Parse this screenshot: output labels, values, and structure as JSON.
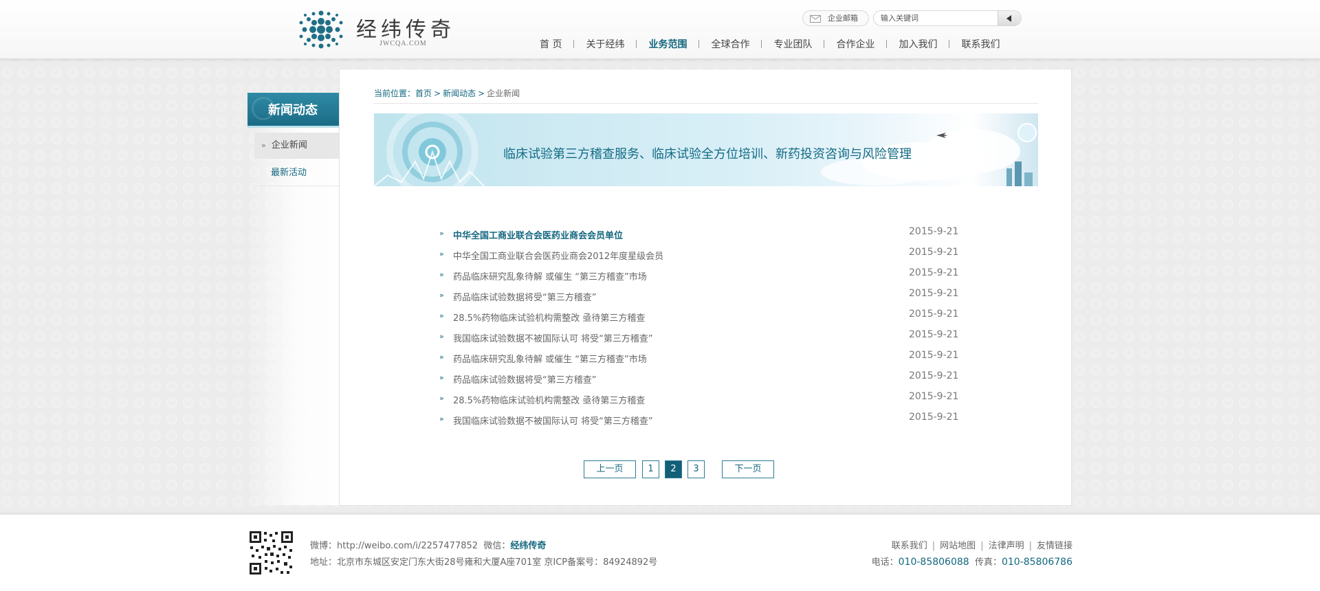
{
  "header": {
    "logo_text": "经纬传奇",
    "logo_sub": "JWCQA.COM",
    "mail_label": "企业邮箱",
    "search_placeholder": "输入关键词",
    "nav": [
      "首 页",
      "关于经纬",
      "业务范围",
      "全球合作",
      "专业团队",
      "合作企业",
      "加入我们",
      "联系我们"
    ],
    "nav_active_index": 2
  },
  "sidebar": {
    "title": "新闻动态",
    "items": [
      {
        "label": "企业新闻",
        "active": true
      },
      {
        "label": "最新活动",
        "active": false
      }
    ]
  },
  "breadcrumb": {
    "prefix": "当前位置：",
    "home": "首页",
    "section": "新闻动态",
    "current": "企业新闻"
  },
  "banner": {
    "text": "临床试验第三方稽查服务、临床试验全方位培训、新药投资咨询与风险管理"
  },
  "news": [
    {
      "title": "中华全国工商业联合会医药业商会会员单位",
      "date": "2015-9-21",
      "highlight": true
    },
    {
      "title": "中华全国工商业联合会医药业商会2012年度星级会员",
      "date": "2015-9-21",
      "highlight": false
    },
    {
      "title": "药品临床研究乱象待解 或催生 “第三方稽查”市场",
      "date": "2015-9-21",
      "highlight": false
    },
    {
      "title": "药品临床试验数据将受“第三方稽查”",
      "date": "2015-9-21",
      "highlight": false
    },
    {
      "title": "28.5%药物临床试验机构需整改 亟待第三方稽查",
      "date": "2015-9-21",
      "highlight": false
    },
    {
      "title": "我国临床试验数据不被国际认可 将受“第三方稽查”",
      "date": "2015-9-21",
      "highlight": false
    },
    {
      "title": "药品临床研究乱象待解 或催生 “第三方稽查”市场",
      "date": "2015-9-21",
      "highlight": false
    },
    {
      "title": "药品临床试验数据将受“第三方稽查”",
      "date": "2015-9-21",
      "highlight": false
    },
    {
      "title": "28.5%药物临床试验机构需整改 亟待第三方稽查",
      "date": "2015-9-21",
      "highlight": false
    },
    {
      "title": "我国临床试验数据不被国际认可 将受“第三方稽查”",
      "date": "2015-9-21",
      "highlight": false
    }
  ],
  "pager": {
    "prev": "上一页",
    "pages": [
      "1",
      "2",
      "3"
    ],
    "current": "2",
    "next": "下一页"
  },
  "footer": {
    "weibo_label": "微博：",
    "weibo": "http://weibo.com/i/2257477852",
    "weixin_label": "微信：",
    "weixin": "经纬传奇",
    "address": "地址：北京市东城区安定门东大街28号雍和大厦A座701室  京ICP备案号：84924892号",
    "links": [
      "联系我们",
      "网站地图",
      "法律声明",
      "友情链接"
    ],
    "phone_label": "电话：",
    "phone": "010-85806088",
    "fax_label": "传真：",
    "fax": "010-85806786"
  },
  "colors": {
    "accent": "#13677f",
    "sidebar_title_bg": "#1b6c86",
    "page_current_bg": "#125f78"
  }
}
